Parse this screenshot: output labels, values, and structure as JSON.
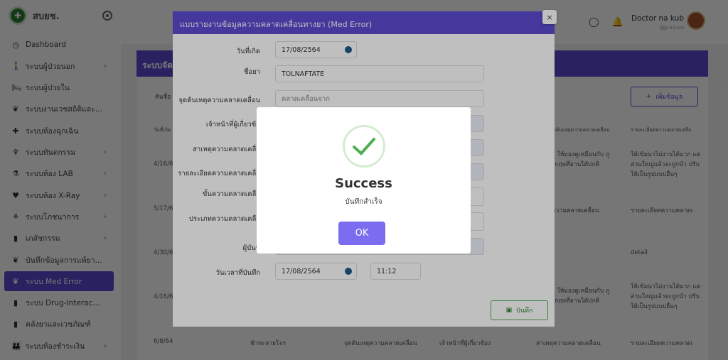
{
  "sidebar": {
    "brand": "สบยช.",
    "items": [
      {
        "label": "Dashboard",
        "icon": "clock-icon",
        "glyph": "◷",
        "chevron": false,
        "active": false
      },
      {
        "label": "ระบบผู้ป่วยนอก",
        "icon": "walking-person-icon",
        "glyph": "🚶",
        "chevron": true,
        "active": false
      },
      {
        "label": "ระบบผู้ป่วยใน",
        "icon": "bed-icon",
        "glyph": "🛏",
        "chevron": false,
        "active": false
      },
      {
        "label": "ระบบงานเวชสถิติและ...",
        "icon": "hand-heart-icon",
        "glyph": "❦",
        "chevron": false,
        "active": false
      },
      {
        "label": "ระบบห้องฉุกเฉิน",
        "icon": "plus-icon",
        "glyph": "✚",
        "chevron": false,
        "active": false
      },
      {
        "label": "ระบบทันตกรรม",
        "icon": "tooth-icon",
        "glyph": "♆",
        "chevron": true,
        "active": false
      },
      {
        "label": "ระบบห้อง LAB",
        "icon": "microscope-icon",
        "glyph": "⚗",
        "chevron": true,
        "active": false
      },
      {
        "label": "ระบบห้อง X-Ray",
        "icon": "heart-pulse-icon",
        "glyph": "♥",
        "chevron": true,
        "active": false
      },
      {
        "label": "ระบบโภชนาการ",
        "icon": "food-icon",
        "glyph": "⚘",
        "chevron": true,
        "active": false
      },
      {
        "label": "เภสัชกรรม",
        "icon": "bottle-icon",
        "glyph": "▮",
        "chevron": true,
        "active": false
      },
      {
        "label": "บันทึกข้อมูลการแพ้ยา...",
        "icon": "hand-heart-icon",
        "glyph": "❦",
        "chevron": false,
        "active": false
      },
      {
        "label": "ระบบ Med Error",
        "icon": "hand-heart-icon",
        "glyph": "❦",
        "chevron": false,
        "active": true
      },
      {
        "label": "ระบบ Drug-Interac...",
        "icon": "bottle-icon",
        "glyph": "▮",
        "chevron": false,
        "active": false
      },
      {
        "label": "คลังยาและเวชภัณฑ์",
        "icon": "bottle-icon",
        "glyph": "▮",
        "chevron": false,
        "active": false
      },
      {
        "label": "ระบบห้องชำระเงิน",
        "icon": "people-icon",
        "glyph": "👪",
        "chevron": true,
        "active": false
      }
    ]
  },
  "header": {
    "user_name": "Doctor na kub",
    "user_role": "ผู้ดูแลระบบ"
  },
  "page": {
    "banner": "ระบบจัด",
    "add_button": "เพิ่มข้อมูล",
    "search_label": "ค้นชื่อ",
    "col_date": "วันที่เกิด",
    "col_error": "จุดต้นเหตุความคลาดเคลื่อน",
    "col_detail": "รายละเอียดความคลาดเคลื่อ",
    "dates": [
      "4/16/6",
      "5/17/6",
      "4/30/6",
      "4/16/6",
      "6/8/64"
    ],
    "cell_a": "า ให้มองดูเหมือนกับ ภูงกฤษที่อานได้ปกติ",
    "cell_b": "ให้เข้มนาไม่งานได้มาก แต่ส่วนใหญ่แล้วจะถูกนำ ปรับให้เป็นรูปแบบอื่นๆ",
    "cell_c": "ความคลาดเคลื่อน",
    "cell_d": "รายละเอียดความคลาดเ",
    "cell_e": "detail",
    "last_row": [
      "6/8/64",
      "ฟ้าทะลายโจร",
      "จุดต้นเหตุความคลาดเคลื่อน",
      "เจ้าหน้าที่ผู้เกี่ยวข้อง",
      "สาเหตุความคลาดเคลื่อน",
      "รายละเอียดความคลาดเ"
    ]
  },
  "form_modal": {
    "title": "แบบรายงานข้อมูลความคลาดเคลื่อนทางยา (Med Error)",
    "close": "×",
    "labels": [
      "วันที่เกิด",
      "ชื่อยา",
      "จุดต้นเหตุความคลาดเคลื่อน",
      "เจ้าหน้าที่ผู้เกี่ยวข้อ",
      "สาเหตุความคลาดเคลื่อ",
      "รายละเอียดความคลาดเคลื่อ",
      "ขั้นความคลาดเคลื่อ",
      "ประเภทความคลาดเคลื่อ",
      "ผู้บันทึ",
      "วันเวลาที่บันทึก"
    ],
    "date_value": "17/08/2564",
    "drug_value": "TOLNAFTATE",
    "cause_value": "คลาดเคลื่อนจาก",
    "record_date": "17/08/2564",
    "record_time": "11:12",
    "save_button": "บันทึก"
  },
  "success_dialog": {
    "title": "Success",
    "message": "บันทึกสำเร็จ",
    "ok": "OK"
  },
  "colors": {
    "accent": "#5c4bd1",
    "ok_button": "#7b6cf0",
    "success_check": "#4caf50"
  }
}
